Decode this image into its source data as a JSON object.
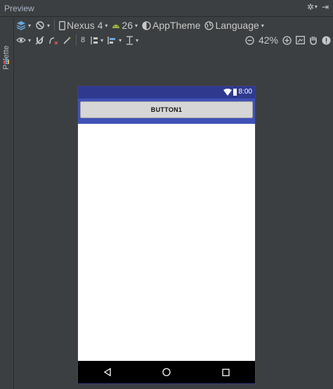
{
  "window": {
    "title": "Preview"
  },
  "sidebar": {
    "palette_label": "Palette"
  },
  "toolbar1": {
    "device": "Nexus 4",
    "api_level": "26",
    "theme": "AppTheme",
    "language": "Language"
  },
  "toolbar2": {
    "margin_value": "8",
    "zoom": "42%"
  },
  "phone": {
    "status_time": "8:00",
    "button_label": "BUTTON1"
  },
  "colors": {
    "status_bar": "#2f3a8f",
    "app_bar": "#3f51b5",
    "nav_bar": "#000000",
    "ide_background": "#3c3f41"
  }
}
